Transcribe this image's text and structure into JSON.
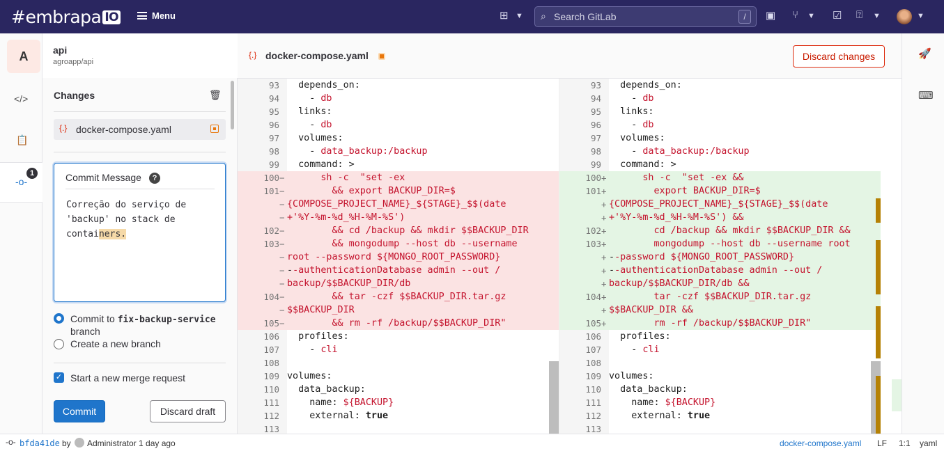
{
  "topbar": {
    "logo_text": "#embrapa",
    "logo_badge": "IO",
    "menu_label": "Menu",
    "search_placeholder": "Search GitLab",
    "search_shortcut": "/"
  },
  "project": {
    "avatar_letter": "A",
    "name": "api",
    "path": "agroapp/api"
  },
  "rail": {
    "badge_count": "1"
  },
  "changes": {
    "title": "Changes",
    "file_name": "docker-compose.yaml"
  },
  "commit": {
    "message_label": "Commit Message",
    "message_plain": "Correção do serviço de\n'backup' no stack de\ncontai",
    "message_highlight": "ners.",
    "option_current_prefix": "Commit to ",
    "option_current_branch": "fix-backup-service",
    "option_current_suffix": "branch",
    "option_new": "Create a new branch",
    "checkbox_label": "Start a new merge request",
    "commit_button": "Commit",
    "discard_draft_button": "Discard draft"
  },
  "editor": {
    "file_name": "docker-compose.yaml",
    "discard_button": "Discard changes"
  },
  "diff": {
    "left": [
      {
        "ln": "93",
        "code": "  depends_on:",
        "type": "ctx"
      },
      {
        "ln": "94",
        "code": "    - db",
        "type": "ctx"
      },
      {
        "ln": "95",
        "code": "  links:",
        "type": "ctx"
      },
      {
        "ln": "96",
        "code": "    - db",
        "type": "ctx"
      },
      {
        "ln": "97",
        "code": "  volumes:",
        "type": "ctx"
      },
      {
        "ln": "98",
        "code": "    - data_backup:/backup",
        "type": "ctx"
      },
      {
        "ln": "99",
        "code": "  command: >",
        "type": "ctx"
      },
      {
        "ln": "100",
        "code": "      sh -c  \"set -ex",
        "type": "del"
      },
      {
        "ln": "101",
        "code": "        && export BACKUP_DIR=$",
        "type": "del"
      },
      {
        "ln": "",
        "code": "{COMPOSE_PROJECT_NAME}_${STAGE}_$$(date",
        "type": "del"
      },
      {
        "ln": "",
        "code": "+'%Y-%m-%d_%H-%M-%S')",
        "type": "del"
      },
      {
        "ln": "102",
        "code": "        && cd /backup && mkdir $$BACKUP_DIR",
        "type": "del"
      },
      {
        "ln": "103",
        "code": "        && mongodump --host db --username",
        "type": "del"
      },
      {
        "ln": "",
        "code": "root --password ${MONGO_ROOT_PASSWORD}",
        "type": "del"
      },
      {
        "ln": "",
        "code": "--authenticationDatabase admin --out /",
        "type": "del"
      },
      {
        "ln": "",
        "code": "backup/$$BACKUP_DIR/db",
        "type": "del"
      },
      {
        "ln": "104",
        "code": "        && tar -czf $$BACKUP_DIR.tar.gz",
        "type": "del"
      },
      {
        "ln": "",
        "code": "$$BACKUP_DIR",
        "type": "del"
      },
      {
        "ln": "105",
        "code": "        && rm -rf /backup/$$BACKUP_DIR\"",
        "type": "del"
      },
      {
        "ln": "106",
        "code": "  profiles:",
        "type": "ctx"
      },
      {
        "ln": "107",
        "code": "    - cli",
        "type": "ctx"
      },
      {
        "ln": "108",
        "code": "",
        "type": "ctx"
      },
      {
        "ln": "109",
        "code": "volumes:",
        "type": "ctx"
      },
      {
        "ln": "110",
        "code": "  data_backup:",
        "type": "ctx"
      },
      {
        "ln": "111",
        "code": "    name: ${BACKUP}",
        "type": "ctx"
      },
      {
        "ln": "112",
        "code": "    external: true",
        "type": "ctx"
      },
      {
        "ln": "113",
        "code": "",
        "type": "ctx"
      }
    ],
    "right": [
      {
        "ln": "93",
        "code": "  depends_on:",
        "type": "ctx"
      },
      {
        "ln": "94",
        "code": "    - db",
        "type": "ctx"
      },
      {
        "ln": "95",
        "code": "  links:",
        "type": "ctx"
      },
      {
        "ln": "96",
        "code": "    - db",
        "type": "ctx"
      },
      {
        "ln": "97",
        "code": "  volumes:",
        "type": "ctx"
      },
      {
        "ln": "98",
        "code": "    - data_backup:/backup",
        "type": "ctx"
      },
      {
        "ln": "99",
        "code": "  command: >",
        "type": "ctx"
      },
      {
        "ln": "100",
        "code": "      sh -c  \"set -ex &&",
        "type": "add"
      },
      {
        "ln": "101",
        "code": "        export BACKUP_DIR=$",
        "type": "add"
      },
      {
        "ln": "",
        "code": "{COMPOSE_PROJECT_NAME}_${STAGE}_$$(date",
        "type": "add"
      },
      {
        "ln": "",
        "code": "+'%Y-%m-%d_%H-%M-%S') &&",
        "type": "add"
      },
      {
        "ln": "102",
        "code": "        cd /backup && mkdir $$BACKUP_DIR &&",
        "type": "add"
      },
      {
        "ln": "103",
        "code": "        mongodump --host db --username root",
        "type": "add"
      },
      {
        "ln": "",
        "code": "--password ${MONGO_ROOT_PASSWORD}",
        "type": "add"
      },
      {
        "ln": "",
        "code": "--authenticationDatabase admin --out /",
        "type": "add"
      },
      {
        "ln": "",
        "code": "backup/$$BACKUP_DIR/db &&",
        "type": "add"
      },
      {
        "ln": "104",
        "code": "        tar -czf $$BACKUP_DIR.tar.gz",
        "type": "add"
      },
      {
        "ln": "",
        "code": "$$BACKUP_DIR &&",
        "type": "add"
      },
      {
        "ln": "105",
        "code": "        rm -rf /backup/$$BACKUP_DIR\"",
        "type": "add"
      },
      {
        "ln": "106",
        "code": "  profiles:",
        "type": "ctx"
      },
      {
        "ln": "107",
        "code": "    - cli",
        "type": "ctx"
      },
      {
        "ln": "108",
        "code": "",
        "type": "ctx"
      },
      {
        "ln": "109",
        "code": "volumes:",
        "type": "ctx"
      },
      {
        "ln": "110",
        "code": "  data_backup:",
        "type": "ctx"
      },
      {
        "ln": "111",
        "code": "    name: ${BACKUP}",
        "type": "ctx"
      },
      {
        "ln": "112",
        "code": "    external: true",
        "type": "ctx"
      },
      {
        "ln": "113",
        "code": "",
        "type": "ctx"
      }
    ]
  },
  "statusbar": {
    "commit_sha": "bfda41de",
    "by": "by",
    "author": "Administrator 1 day ago",
    "file": "docker-compose.yaml",
    "eol": "LF",
    "position": "1:1",
    "language": "yaml"
  }
}
